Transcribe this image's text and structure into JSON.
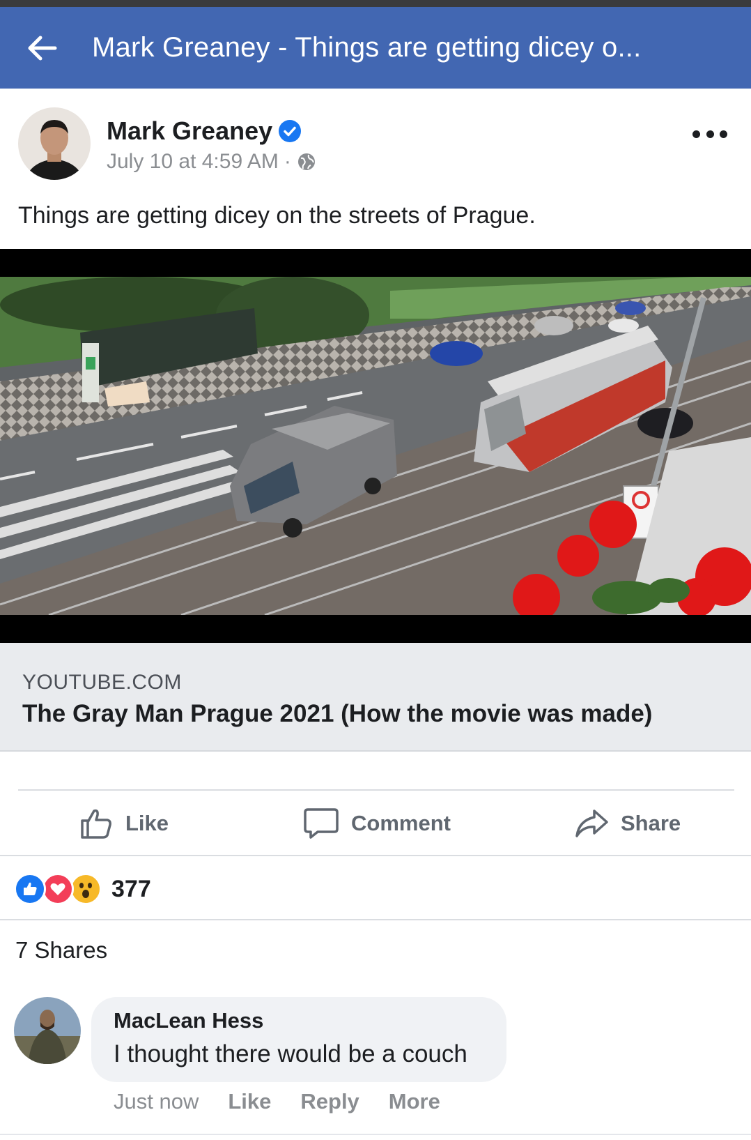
{
  "topbar": {
    "title": "Mark Greaney - Things are getting dicey o...",
    "back_icon": "arrow-left-icon",
    "background": "#4267b2"
  },
  "post": {
    "author": "Mark Greaney",
    "verified_icon": "verified-badge-icon",
    "timestamp": "July 10 at 4:59 AM",
    "separator": "·",
    "privacy_icon": "globe-icon",
    "text": "Things are getting dicey on the streets of Prague."
  },
  "link_card": {
    "domain": "YOUTUBE.COM",
    "title": "The Gray Man Prague 2021 (How the movie was made)"
  },
  "actions": {
    "like": "Like",
    "comment": "Comment",
    "share": "Share"
  },
  "reactions": {
    "icons": [
      "like-reaction-icon",
      "love-reaction-icon",
      "wow-reaction-icon"
    ],
    "count": "377"
  },
  "shares": "7 Shares",
  "comment": {
    "author": "MacLean Hess",
    "text": "I thought there would be a couch",
    "time": "Just now",
    "like": "Like",
    "reply": "Reply",
    "more": "More"
  },
  "colors": {
    "brand_blue": "#4267b2",
    "like_blue": "#1877f2",
    "love_red": "#f33e58",
    "wow_yellow": "#f7b928",
    "muted_text": "#8a8d91"
  }
}
